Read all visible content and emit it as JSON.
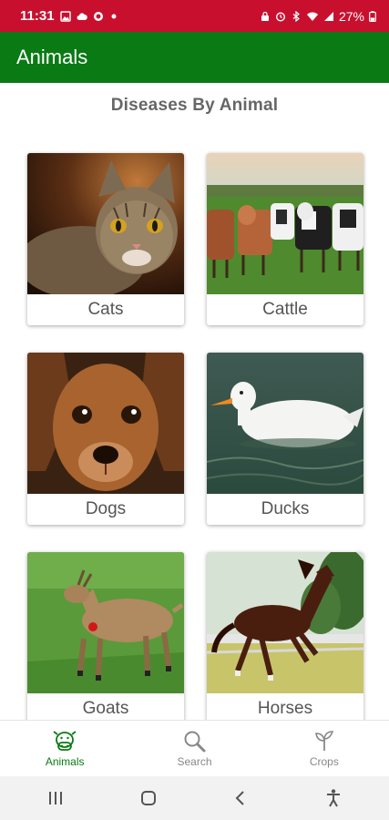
{
  "status": {
    "time": "11:31",
    "battery": "27%"
  },
  "app_bar": {
    "title": "Animals"
  },
  "main": {
    "section_title": "Diseases By Animal",
    "cards": [
      {
        "label": "Cats",
        "icon": "cat-photo"
      },
      {
        "label": "Cattle",
        "icon": "cattle-photo"
      },
      {
        "label": "Dogs",
        "icon": "dog-photo"
      },
      {
        "label": "Ducks",
        "icon": "duck-photo"
      },
      {
        "label": "Goats",
        "icon": "goat-photo"
      },
      {
        "label": "Horses",
        "icon": "horse-photo"
      }
    ]
  },
  "bottom_nav": {
    "items": [
      {
        "label": "Animals",
        "icon": "cow-icon",
        "active": true
      },
      {
        "label": "Search",
        "icon": "search-icon",
        "active": false
      },
      {
        "label": "Crops",
        "icon": "sprout-icon",
        "active": false
      }
    ]
  },
  "colors": {
    "status_bar": "#c8102e",
    "app_bar": "#0a7a14",
    "active_nav": "#0a7a14",
    "inactive_nav": "#888888",
    "title_text": "#666666"
  }
}
